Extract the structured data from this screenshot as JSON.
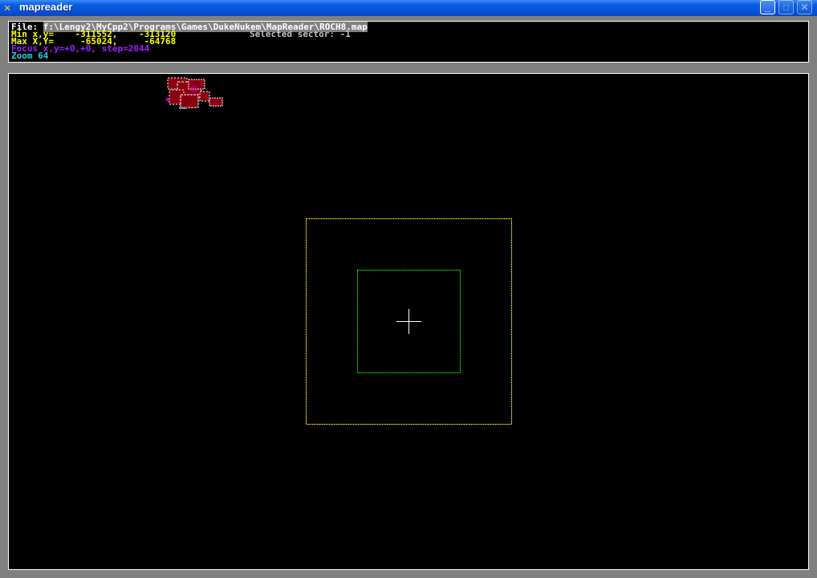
{
  "window": {
    "title": "mapreader",
    "icon": "tools-icon"
  },
  "info": {
    "file_label": "File: ",
    "file_path": "f:\\Lengy2\\MyCpp2\\Programs\\Games\\DukeNukem\\MapReader\\ROCH8.map",
    "min": "Min x,y=    -311552,    -313120",
    "max": "Max X,Y=     -65024,     -64768",
    "focus": "Focus x,y=+0,+0, step=2044",
    "zoom": "Zoom 64",
    "selected": "Selected sector: -1"
  },
  "colors": {
    "outer_box": "#ffff00",
    "inner_box": "#00ff00",
    "sectors": "#8b0010",
    "walls": "#ffffff"
  }
}
